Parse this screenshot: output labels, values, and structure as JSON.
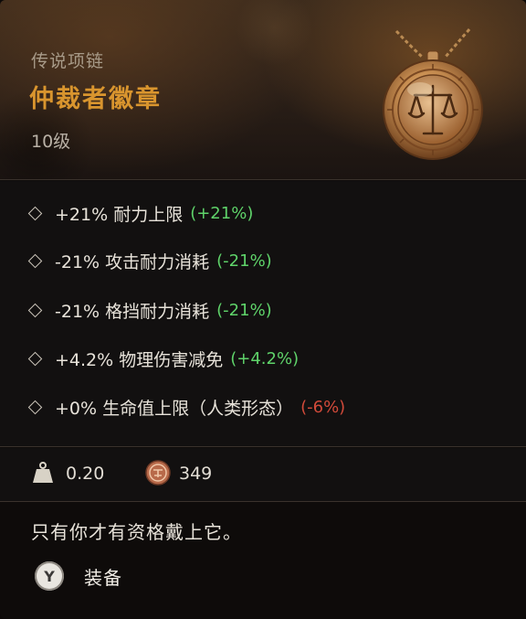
{
  "item": {
    "rarity": "传说项链",
    "name": "仲裁者徽章",
    "level": "10级",
    "icon": "amulet-scales-icon"
  },
  "stats": [
    {
      "text": "+21% 耐力上限",
      "delta": "(+21%)",
      "delta_type": "positive"
    },
    {
      "text": "-21% 攻击耐力消耗",
      "delta": "(-21%)",
      "delta_type": "positive"
    },
    {
      "text": "-21% 格挡耐力消耗",
      "delta": "(-21%)",
      "delta_type": "positive"
    },
    {
      "text": "+4.2% 物理伤害减免",
      "delta": "(+4.2%)",
      "delta_type": "positive"
    },
    {
      "text": "+0% 生命值上限（人类形态）",
      "delta": "(-6%)",
      "delta_type": "negative"
    }
  ],
  "meta": {
    "weight": "0.20",
    "value": "349",
    "weight_icon": "weight-icon",
    "value_icon": "coin-icon"
  },
  "flavor_text": "只有你才有资格戴上它。",
  "action": {
    "button": "Y",
    "label": "装备"
  },
  "colors": {
    "name_color": "#d9952e",
    "positive": "#5fd36a",
    "negative": "#d24a3a"
  }
}
